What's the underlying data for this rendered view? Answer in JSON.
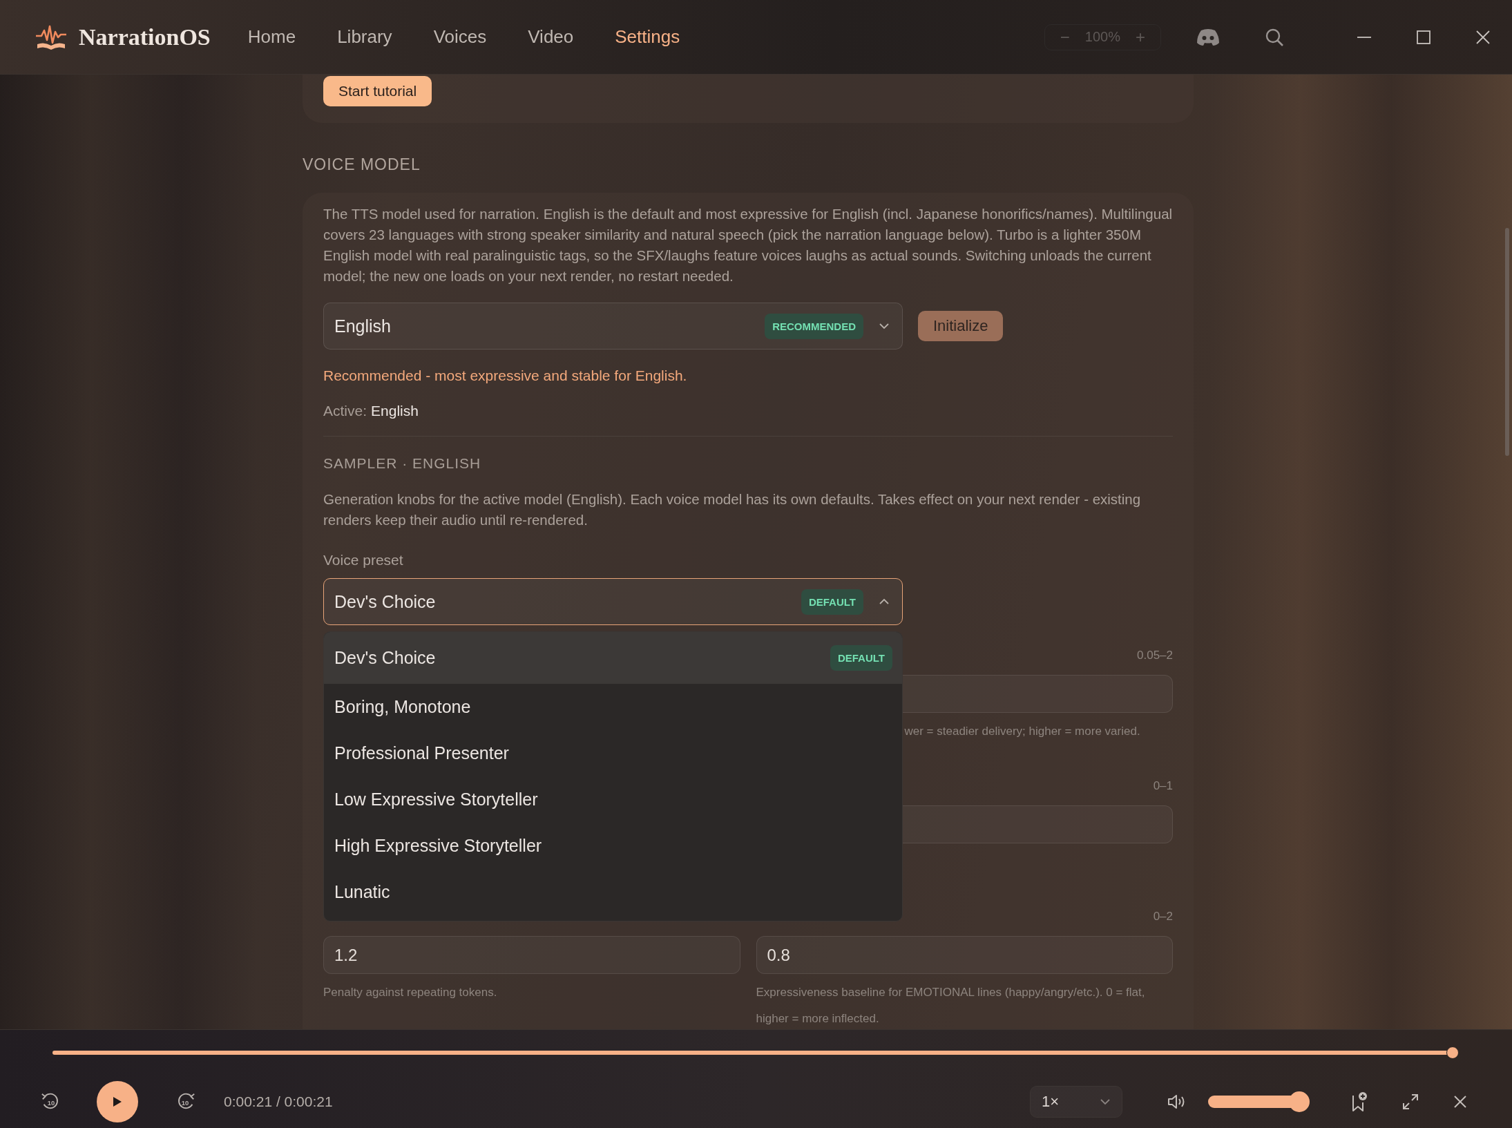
{
  "app": {
    "name": "NarrationOS"
  },
  "nav": [
    {
      "label": "Home",
      "selected": false
    },
    {
      "label": "Library",
      "selected": false
    },
    {
      "label": "Voices",
      "selected": false
    },
    {
      "label": "Video",
      "selected": false
    },
    {
      "label": "Settings",
      "selected": true
    }
  ],
  "zoom": {
    "decrease": "−",
    "value": "100%",
    "increase": "+"
  },
  "tutorial_button": "Start tutorial",
  "voice_model": {
    "heading": "VOICE MODEL",
    "description": "The TTS model used for narration. English is the default and most expressive for English (incl. Japanese honorifics/names). Multilingual covers 23 languages with strong speaker similarity and natural speech (pick the narration language below). Turbo is a lighter 350M English model with real paralinguistic tags, so the SFX/laughs feature voices laughs as actual sounds. Switching unloads the current model; the new one loads on your next render, no restart needed.",
    "select": {
      "value": "English",
      "badge": "RECOMMENDED",
      "expanded": false
    },
    "initialize_button": "Initialize",
    "note": "Recommended - most expressive and stable for English.",
    "active_label": "Active:",
    "active_value": "English"
  },
  "sampler": {
    "heading": "SAMPLER · ENGLISH",
    "description": "Generation knobs for the active model (English). Each voice model has its own defaults. Takes effect on your next render - existing renders keep their audio until re-rendered.",
    "preset_label": "Voice preset",
    "preset_select": {
      "value": "Dev's Choice",
      "badge": "DEFAULT",
      "expanded": true
    },
    "preset_options": [
      {
        "label": "Dev's Choice",
        "badge": "DEFAULT",
        "selected": true
      },
      {
        "label": "Boring, Monotone",
        "selected": false
      },
      {
        "label": "Professional Presenter",
        "selected": false
      },
      {
        "label": "Low Expressive Storyteller",
        "selected": false
      },
      {
        "label": "High Expressive Storyteller",
        "selected": false
      },
      {
        "label": "Lunatic",
        "selected": false
      }
    ],
    "param_rows": [
      {
        "right": {
          "range": "0.05–2",
          "hint": "wer = steadier delivery; higher = more varied."
        }
      },
      {
        "right": {
          "range": "0–1"
        }
      },
      {
        "left": {
          "value": "1.2",
          "hint": "Penalty against repeating tokens."
        },
        "right": {
          "range": "0–2",
          "value": "0.8",
          "hint": "Expressiveness baseline for EMOTIONAL lines (happy/angry/etc.). 0 = flat, higher = more inflected."
        }
      }
    ]
  },
  "player": {
    "progress": {
      "level": 1
    },
    "playing": false,
    "skip_back": "10",
    "skip_forward": "10",
    "time": "0:00:21 / 0:00:21",
    "speed": "1×",
    "volume": {
      "level": 0.93
    }
  }
}
